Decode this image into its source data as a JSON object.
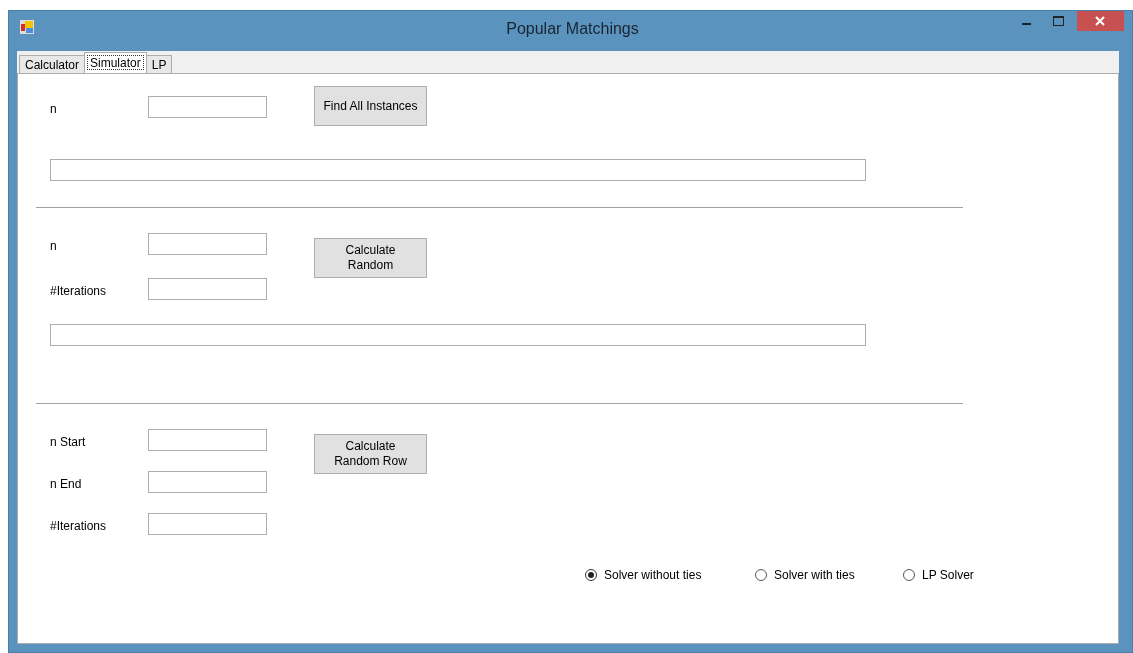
{
  "window": {
    "title": "Popular Matchings"
  },
  "tabs": [
    {
      "label": "Calculator",
      "selected": false
    },
    {
      "label": "Simulator",
      "selected": true
    },
    {
      "label": "LP",
      "selected": false
    }
  ],
  "sections": [
    {
      "fields": [
        {
          "label": "n"
        }
      ],
      "button": "Find All Instances",
      "has_output": true
    },
    {
      "fields": [
        {
          "label": "n"
        },
        {
          "label": "#Iterations"
        }
      ],
      "button": "Calculate\nRandom",
      "has_output": true
    },
    {
      "fields": [
        {
          "label": "n Start"
        },
        {
          "label": "n End"
        },
        {
          "label": "#Iterations"
        }
      ],
      "button": "Calculate\nRandom Row",
      "has_output": false
    }
  ],
  "solver_options": [
    {
      "label": "Solver without ties",
      "selected": true
    },
    {
      "label": "Solver with ties",
      "selected": false
    },
    {
      "label": "LP Solver",
      "selected": false
    }
  ]
}
